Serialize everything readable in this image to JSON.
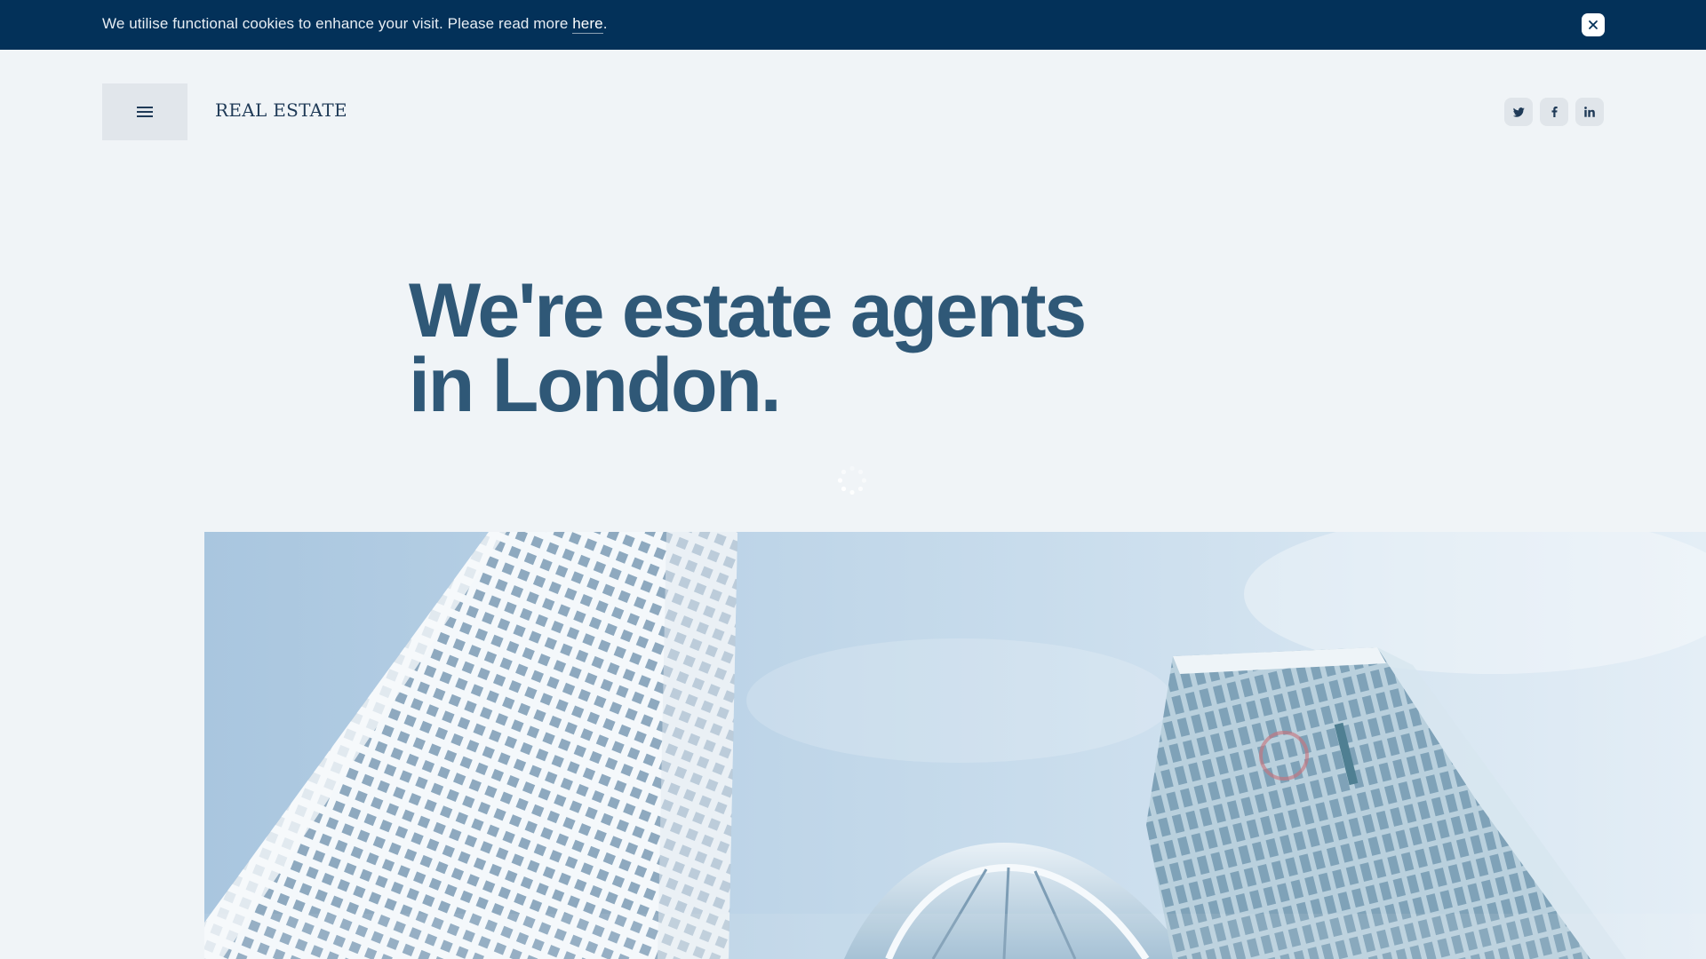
{
  "cookie_banner": {
    "text_before": "We utilise functional cookies to enhance your visit. Please read more ",
    "link_label": "here",
    "text_after": ".",
    "close_icon": "close-icon"
  },
  "header": {
    "menu_icon": "hamburger-menu-icon",
    "brand": "REAL ESTATE",
    "social": [
      {
        "name": "twitter",
        "icon": "twitter-icon"
      },
      {
        "name": "facebook",
        "icon": "facebook-icon"
      },
      {
        "name": "linkedin",
        "icon": "linkedin-icon"
      }
    ]
  },
  "hero": {
    "title_line1": "We're estate agents",
    "title_line2": "in London.",
    "loader_icon": "loading-spinner-icon",
    "image_subject": "skyscrapers-photo"
  },
  "colors": {
    "banner_bg": "#033159",
    "page_bg": "#f0f4f7",
    "heading": "#2f5877",
    "brand_text": "#1f3a57",
    "button_bg": "#e1e6eb"
  }
}
